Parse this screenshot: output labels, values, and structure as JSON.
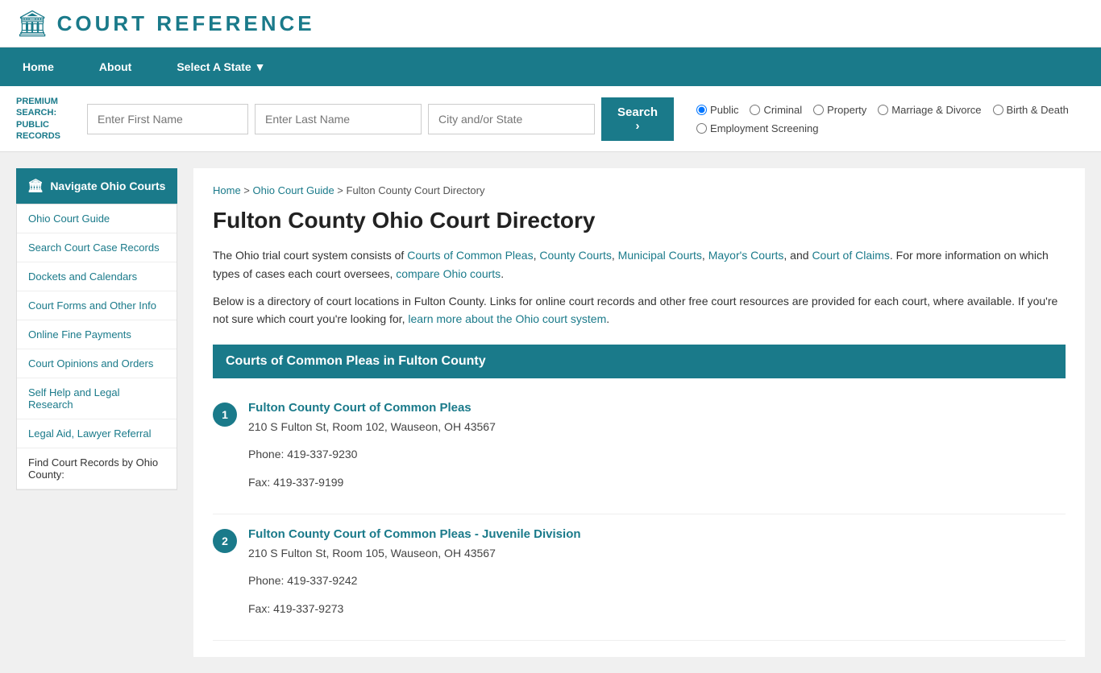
{
  "header": {
    "logo_icon": "🏛",
    "logo_text": "COURT REFERENCE"
  },
  "nav": {
    "items": [
      {
        "label": "Home",
        "href": "#"
      },
      {
        "label": "About",
        "href": "#"
      },
      {
        "label": "Select A State ▼",
        "href": "#"
      }
    ]
  },
  "search_bar": {
    "premium_label": "PREMIUM SEARCH: PUBLIC RECORDS",
    "first_name_placeholder": "Enter First Name",
    "last_name_placeholder": "Enter Last Name",
    "city_placeholder": "City and/or State",
    "search_button": "Search  ›",
    "radio_options": [
      {
        "label": "Public",
        "value": "public",
        "checked": true
      },
      {
        "label": "Criminal",
        "value": "criminal"
      },
      {
        "label": "Property",
        "value": "property"
      },
      {
        "label": "Marriage & Divorce",
        "value": "marriage"
      },
      {
        "label": "Birth & Death",
        "value": "birth"
      },
      {
        "label": "Employment Screening",
        "value": "employment"
      }
    ]
  },
  "sidebar": {
    "header": "Navigate Ohio Courts",
    "items": [
      {
        "label": "Ohio Court Guide"
      },
      {
        "label": "Search Court Case Records"
      },
      {
        "label": "Dockets and Calendars"
      },
      {
        "label": "Court Forms and Other Info"
      },
      {
        "label": "Online Fine Payments"
      },
      {
        "label": "Court Opinions and Orders"
      },
      {
        "label": "Self Help and Legal Research"
      },
      {
        "label": "Legal Aid, Lawyer Referral"
      }
    ],
    "find_records_label": "Find Court Records by Ohio County:"
  },
  "breadcrumb": {
    "home": "Home",
    "guide": "Ohio Court Guide",
    "current": "Fulton County Court Directory"
  },
  "content": {
    "title": "Fulton County Ohio Court Directory",
    "intro_p1_before": "The Ohio trial court system consists of ",
    "intro_links": [
      "Courts of Common Pleas",
      "County Courts",
      "Municipal Courts",
      "Mayor's Courts",
      "Court of Claims"
    ],
    "intro_p1_after": ". For more information on which types of cases each court oversees, ",
    "compare_link": "compare Ohio courts",
    "intro_p2": "Below is a directory of court locations in Fulton County. Links for online court records and other free court resources are provided for each court, where available. If you're not sure which court you're looking for, ",
    "learn_link": "learn more about the Ohio court system",
    "section_header": "Courts of Common Pleas in Fulton County",
    "courts": [
      {
        "number": 1,
        "name": "Fulton County Court of Common Pleas",
        "address": "210 S Fulton St, Room 102, Wauseon, OH 43567",
        "phone": "Phone: 419-337-9230",
        "fax": "Fax: 419-337-9199"
      },
      {
        "number": 2,
        "name": "Fulton County Court of Common Pleas - Juvenile Division",
        "address": "210 S Fulton St, Room 105, Wauseon, OH 43567",
        "phone": "Phone: 419-337-9242",
        "fax": "Fax: 419-337-9273"
      }
    ]
  }
}
